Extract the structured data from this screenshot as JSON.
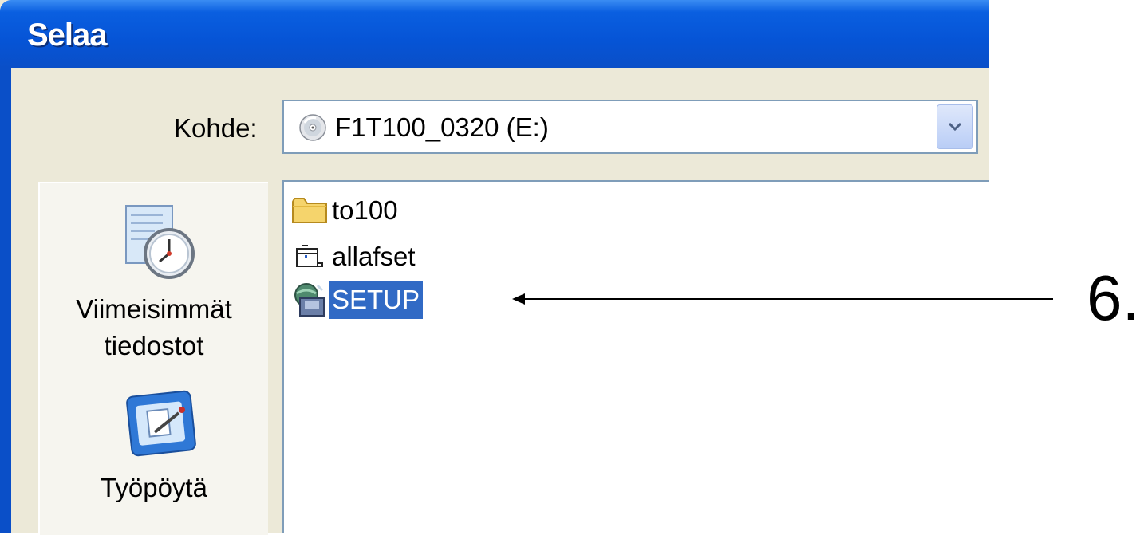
{
  "window": {
    "title": "Selaa"
  },
  "lookin": {
    "label": "Kohde:",
    "value": "F1T100_0320 (E:)"
  },
  "places": [
    {
      "label_line1": "Viimeisimmät",
      "label_line2": "tiedostot",
      "icon": "recent-documents-icon"
    },
    {
      "label_line1": "Työpöytä",
      "icon": "desktop-icon"
    }
  ],
  "files": [
    {
      "name": "to100",
      "icon": "folder-icon",
      "selected": false
    },
    {
      "name": "allafset",
      "icon": "setup-folder-icon",
      "selected": false
    },
    {
      "name": "SETUP",
      "icon": "setup-program-icon",
      "selected": true
    }
  ],
  "annotation": {
    "step": "6."
  },
  "colors": {
    "titlebar": "#0654d6",
    "selection": "#316ac5",
    "dialog_bg": "#ece9d8"
  }
}
